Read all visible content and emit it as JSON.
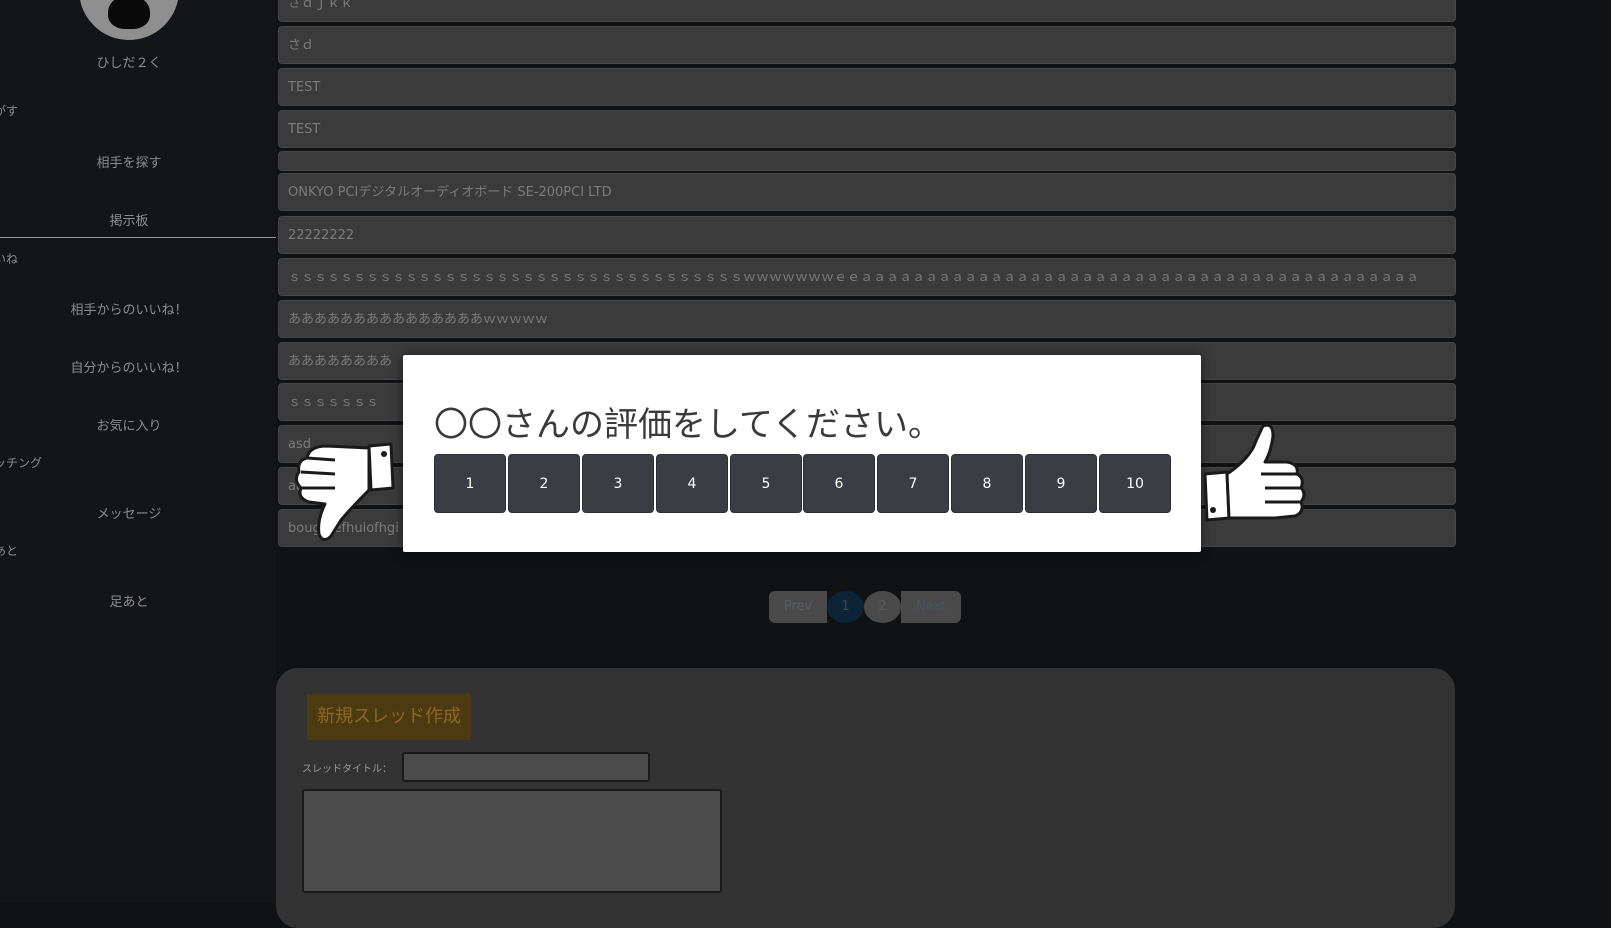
{
  "sidebar": {
    "username": "ひしだ２く",
    "section_search_partial": "がす",
    "find_partner": "相手を探す",
    "bulletin_board": "掲示板",
    "section_likes_partial": "いね",
    "likes_from_partner": "相手からのいいね！",
    "likes_from_me": "自分からのいいね！",
    "favorites": "お気に入り",
    "section_matching_partial": "ッチング",
    "messages": "メッセージ",
    "section_footprints_partial": "あと",
    "footprints": "足あと"
  },
  "threads": [
    "さｄｊｋｋ",
    "さｄ",
    "TEST",
    "TEST",
    "",
    "ONKYO PCIデジタルオーディオボード SE-200PCI LTD",
    "22222222",
    "ｓｓｓｓｓｓｓｓｓｓｓｓｓｓｓｓｓｓｓｓｓｓｓｓｓｓｓｓｓｓｓｓｓｓｓｗｗｗｗｗｗｗｅｅａａａａａａａａａａａａａａａａａａａａａａａａａａａａａａａａａａａａａａａａａａａ",
    "あああああああああああああああｗｗｗｗｗ",
    "ああああああああ",
    "ｓｓｓｓｓｓｓ",
    "asd",
    "aaaaaaaa",
    "bougbfefhuiofhgi"
  ],
  "pagination": {
    "prev": "Prev",
    "pages": [
      "1",
      "2"
    ],
    "current": "1",
    "next": "Next"
  },
  "new_thread": {
    "heading": "新規スレッド作成",
    "title_label": "スレッドタイトル：",
    "title_value": "",
    "body_value": ""
  },
  "rating_modal": {
    "title": "〇〇さんの評価をしてください。",
    "options": [
      "1",
      "2",
      "3",
      "4",
      "5",
      "6",
      "7",
      "8",
      "9",
      "10"
    ],
    "left_icon": "thumbs-down-icon",
    "right_icon": "thumbs-up-icon"
  },
  "colors": {
    "background": "#111214",
    "row": "#3b3b3c",
    "modal_bg": "#ffffff",
    "rating_button": "#3a3d44",
    "new_thread_heading": "#4e3a10"
  }
}
